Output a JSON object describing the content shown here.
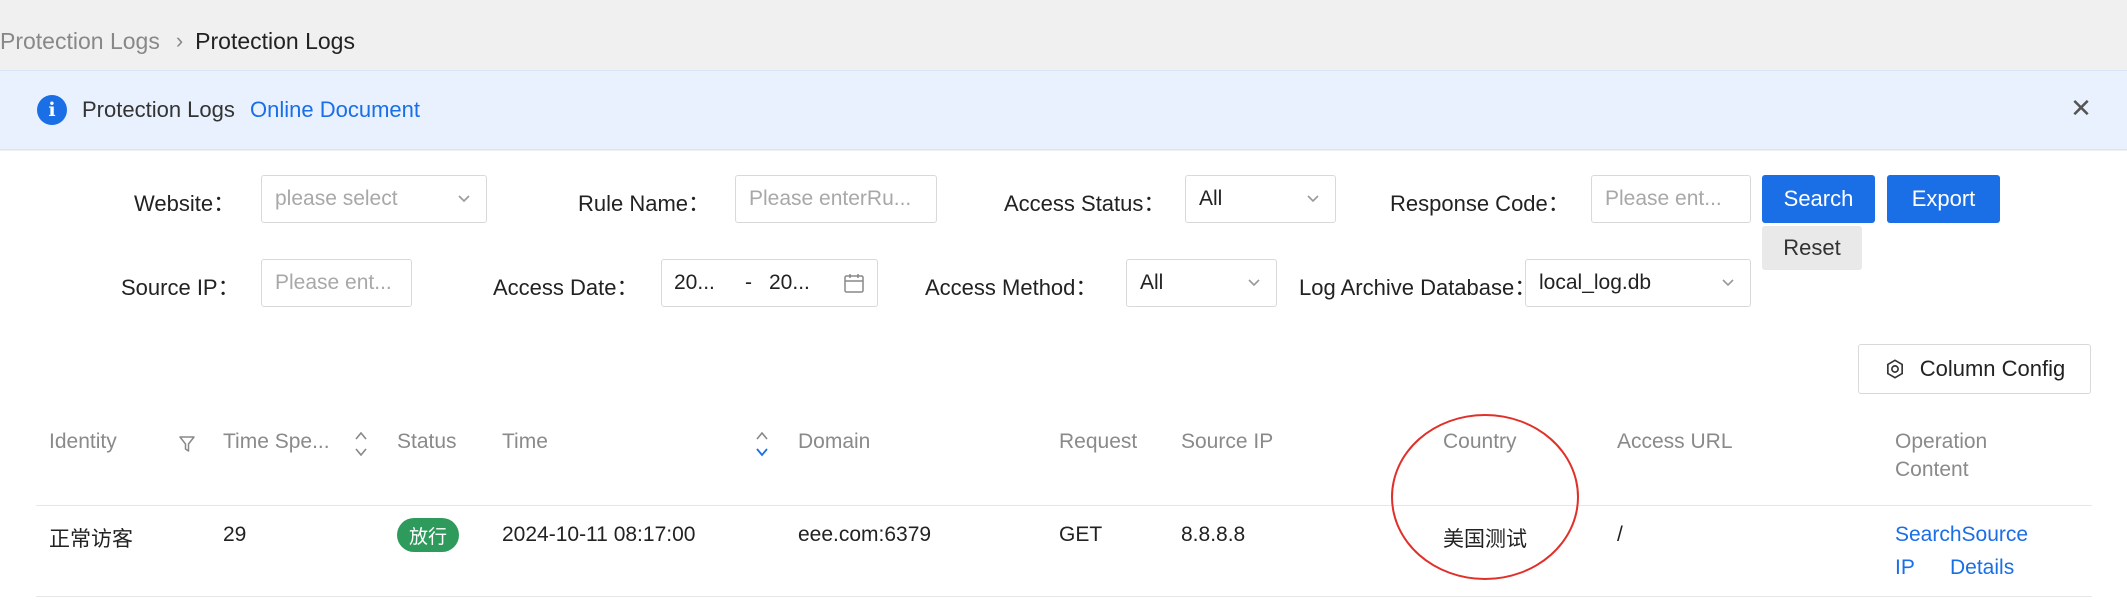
{
  "breadcrumb": {
    "parent": "Protection Logs",
    "current": "Protection Logs"
  },
  "alert": {
    "text": "Protection Logs",
    "link": "Online Document",
    "close_icon": "close-icon"
  },
  "filters": {
    "website": {
      "label": "Website",
      "placeholder": "please select"
    },
    "rule_name": {
      "label": "Rule Name",
      "placeholder": "Please enterRu..."
    },
    "access_status": {
      "label": "Access Status",
      "value": "All"
    },
    "response_code": {
      "label": "Response Code",
      "placeholder": "Please ent..."
    },
    "source_ip": {
      "label": "Source IP",
      "placeholder": "Please ent..."
    },
    "access_date": {
      "label": "Access Date",
      "start": "20...",
      "separator": "-",
      "end": "20..."
    },
    "access_method": {
      "label": "Access Method",
      "value": "All"
    },
    "log_archive_db": {
      "label": "Log Archive Database",
      "value": "local_log.db"
    },
    "label_colon": "："
  },
  "buttons": {
    "search": "Search",
    "export": "Export",
    "reset": "Reset",
    "column_config": "Column Config"
  },
  "table": {
    "headers": {
      "identity": "Identity",
      "time_spent": "Time Spe...",
      "status": "Status",
      "time": "Time",
      "domain": "Domain",
      "request": "Request",
      "source_ip": "Source IP",
      "country": "Country",
      "access_url": "Access URL",
      "operation_line1": "Operation",
      "operation_line2": "Content"
    },
    "rows": [
      {
        "identity": "正常访客",
        "time_spent": "29",
        "status": "放行",
        "time": "2024-10-11 08:17:00",
        "domain": "eee.com:6379",
        "request": "GET",
        "source_ip": "8.8.8.8",
        "country": "美国测试",
        "access_url": "/",
        "op_search_line1": "SearchSource",
        "op_search_line2": "IP",
        "op_details": "Details"
      }
    ]
  },
  "colors": {
    "primary": "#1a6ee6",
    "status_green": "#2e9a5b",
    "annotation_red": "#e0302a"
  }
}
